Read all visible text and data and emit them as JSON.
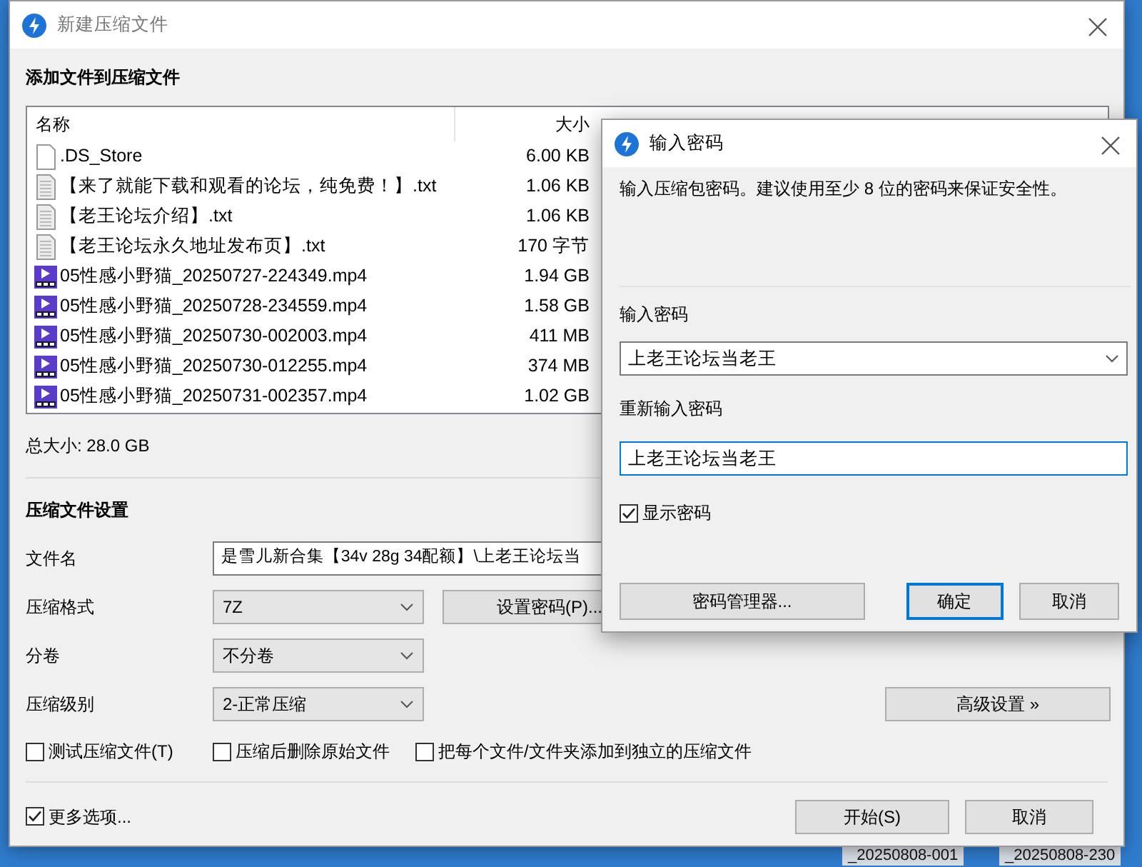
{
  "main_window": {
    "title": "新建压缩文件",
    "heading": "添加文件到压缩文件",
    "file_list": {
      "columns": [
        "名称",
        "大小"
      ],
      "rows": [
        {
          "kind": "file",
          "name": ".DS_Store",
          "size": "6.00 KB"
        },
        {
          "kind": "text",
          "name": "【来了就能下载和观看的论坛，纯免费！】.txt",
          "size": "1.06 KB"
        },
        {
          "kind": "text",
          "name": "【老王论坛介绍】.txt",
          "size": "1.06 KB"
        },
        {
          "kind": "text",
          "name": "【老王论坛永久地址发布页】.txt",
          "size": "170 字节"
        },
        {
          "kind": "video",
          "name": "05性感小野猫_20250727-224349.mp4",
          "size": "1.94 GB"
        },
        {
          "kind": "video",
          "name": "05性感小野猫_20250728-234559.mp4",
          "size": "1.58 GB"
        },
        {
          "kind": "video",
          "name": "05性感小野猫_20250730-002003.mp4",
          "size": "411 MB"
        },
        {
          "kind": "video",
          "name": "05性感小野猫_20250730-012255.mp4",
          "size": "374 MB"
        },
        {
          "kind": "video",
          "name": "05性感小野猫_20250731-002357.mp4",
          "size": "1.02 GB"
        }
      ]
    },
    "total_size": "总大小: 28.0 GB",
    "settings_heading": "压缩文件设置",
    "filename": {
      "label": "文件名",
      "value": "是雪儿新合集【34v 28g 34配额】\\上老王论坛当"
    },
    "combos": [
      {
        "label": "压缩格式",
        "value": "7Z"
      },
      {
        "label": "分卷",
        "value": "不分卷"
      },
      {
        "label": "压缩级别",
        "value": "2-正常压缩"
      }
    ],
    "set_password_button": "设置密码(P)...",
    "advanced_button": "高级设置 »",
    "options": [
      {
        "label": "测试压缩文件(T)",
        "checked": false
      },
      {
        "label": "压缩后删除原始文件",
        "checked": false
      },
      {
        "label": "把每个文件/文件夹添加到独立的压缩文件",
        "checked": false
      }
    ],
    "more_options": {
      "label": "更多选项...",
      "checked": true
    },
    "buttons": [
      "开始(S)",
      "取消"
    ]
  },
  "password_dialog": {
    "title": "输入密码",
    "description": "输入压缩包密码。建议使用至少 8 位的密码来保证安全性。",
    "password_label": "输入密码",
    "password_value": "上老王论坛当老王",
    "repeat_label": "重新输入密码",
    "repeat_value": "上老王论坛当老王",
    "show_password": {
      "label": "显示密码",
      "checked": true
    },
    "buttons": [
      "密码管理器...",
      "确定",
      "取消"
    ]
  },
  "desktop_labels": [
    "_20250808-001",
    "_20250808-230"
  ]
}
